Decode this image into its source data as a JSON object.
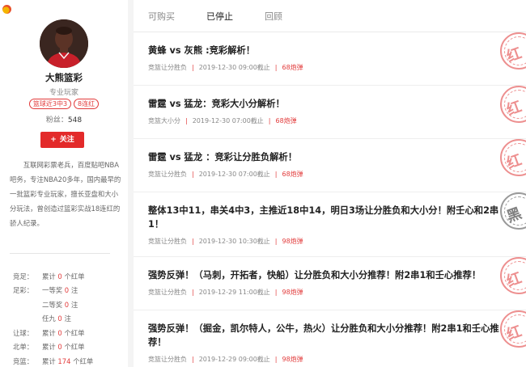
{
  "profile": {
    "name": "大熊篮彩",
    "title": "专业玩家",
    "badges": [
      "篮球近3中3",
      "8连红"
    ],
    "fans_label": "粉丝：",
    "fans_count": "548",
    "follow_label": "关注",
    "bio": "互联网彩票老兵，百度贴吧NBA吧务，专注NBA20多年，国内最早的一批篮彩专业玩家，擅长亚盘和大小分玩法，曾创造过篮彩实战18连红的骄人纪录。"
  },
  "stats": [
    {
      "label": "竞足：",
      "prefix": "累计",
      "num": "0",
      "suffix": "个红单"
    },
    {
      "label": "足彩：",
      "prefix": "一等奖",
      "num": "0",
      "suffix": "注"
    },
    {
      "label": "",
      "prefix": "二等奖",
      "num": "0",
      "suffix": "注"
    },
    {
      "label": "",
      "prefix": "任九",
      "num": "0",
      "suffix": "注"
    },
    {
      "label": "让球：",
      "prefix": "累计",
      "num": "0",
      "suffix": "个红单"
    },
    {
      "label": "北单：",
      "prefix": "累计",
      "num": "0",
      "suffix": "个红单"
    },
    {
      "label": "竞篮：",
      "prefix": "累计",
      "num": "174",
      "suffix": "个红单"
    }
  ],
  "tabs": [
    "可购买",
    "已停止",
    "回顾"
  ],
  "posts": [
    {
      "title": "黄蜂 vs 灰熊 :竞彩解析！",
      "category": "竞篮让分胜负",
      "time": "2019-12-30 09:00截止",
      "count": "68炮弹",
      "stamp": "红"
    },
    {
      "title": "雷霆 vs 猛龙：竞彩大小分解析！",
      "category": "竞篮大小分",
      "time": "2019-12-30 07:00截止",
      "count": "68炮弹",
      "stamp": "红"
    },
    {
      "title": "雷霆 vs 猛龙 ：竞彩让分胜负解析！",
      "category": "竞篮让分胜负",
      "time": "2019-12-30 07:00截止",
      "count": "68炮弹",
      "stamp": "红"
    },
    {
      "title": "整体13中11，串关4中3，主推近18中14，明日3场让分胜负和大小分！附壬心和2串1！",
      "category": "竞篮让分胜负",
      "time": "2019-12-30 10:30截止",
      "count": "98炮弹",
      "stamp": "黑"
    },
    {
      "title": "强势反弹！（马刺，开拓者，快船）让分胜负和大小分推荐！附2串1和壬心推荐！",
      "category": "竞篮让分胜负",
      "time": "2019-12-29 11:00截止",
      "count": "98炮弹",
      "stamp": "红"
    },
    {
      "title": "强势反弹！（掘金，凯尔特人，公牛，热火）让分胜负和大小分推荐！附2串1和壬心推荐！",
      "category": "竞篮让分胜负",
      "time": "2019-12-29 09:00截止",
      "count": "98炮弹",
      "stamp": "红"
    }
  ]
}
